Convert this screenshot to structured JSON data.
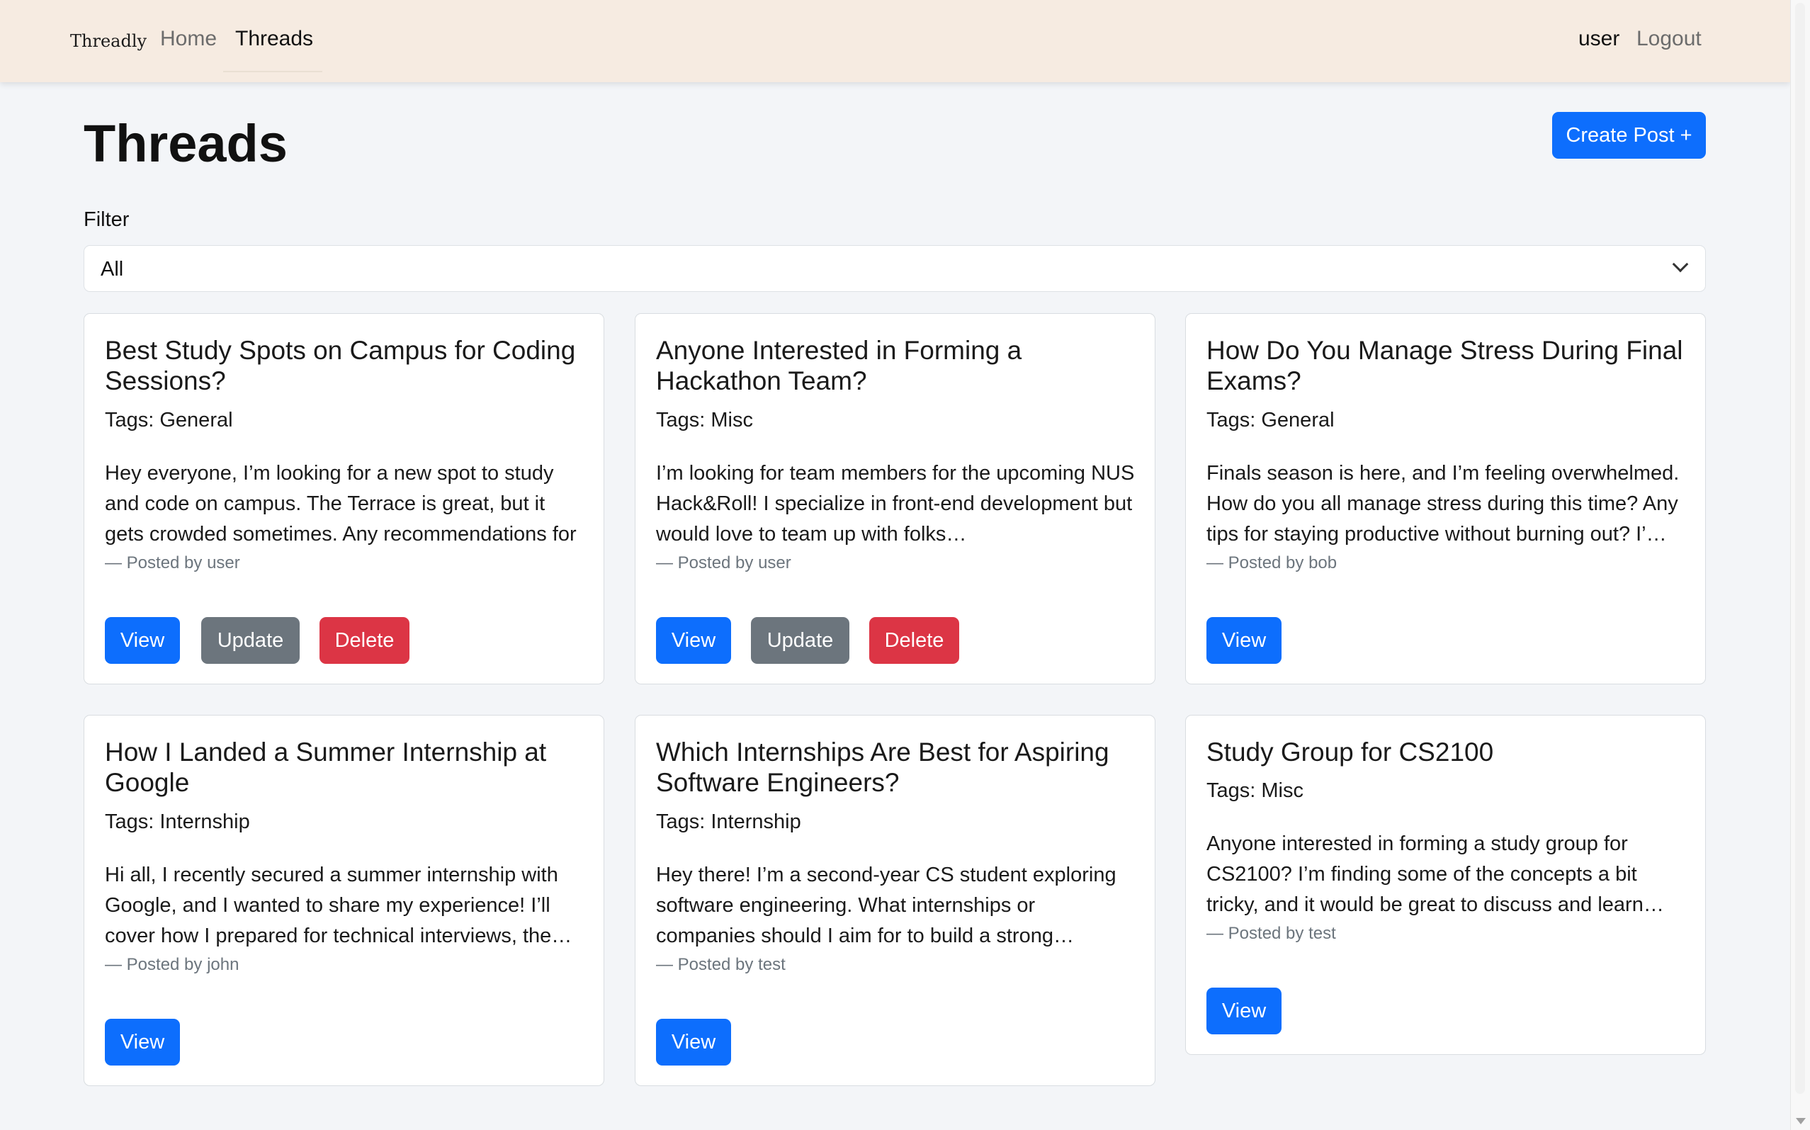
{
  "nav": {
    "brand": "Threadly",
    "home": "Home",
    "threads": "Threads",
    "user": "user",
    "logout": "Logout"
  },
  "header": {
    "title": "Threads",
    "create_label": "Create Post +"
  },
  "filter": {
    "label": "Filter",
    "value": "All"
  },
  "buttons": {
    "view": "View",
    "update": "Update",
    "delete": "Delete"
  },
  "threads": [
    {
      "title": "Best Study Spots on Campus for Coding Sessions?",
      "tags": "Tags: General",
      "body": "Hey everyone, I’m looking for a new spot to study and code on campus. The Terrace is great, but it gets crowded sometimes. Any recommendations for qui…",
      "author": "— Posted by user"
    },
    {
      "title": "Anyone Interested in Forming a Hackathon Team?",
      "tags": "Tags: Misc",
      "body": "I’m looking for team members for the upcoming NUS Hack&Roll! I specialize in front-end development but would love to team up with folks…",
      "author": "— Posted by user"
    },
    {
      "title": "How Do You Manage Stress During Final Exams?",
      "tags": "Tags: General",
      "body": "Finals season is here, and I’m feeling overwhelmed. How do you all manage stress during this time? Any tips for staying productive without burning out? I’…",
      "author": "— Posted by bob"
    },
    {
      "title": "How I Landed a Summer Internship at Google",
      "tags": "Tags: Internship",
      "body": "Hi all, I recently secured a summer internship with Google, and I wanted to share my experience! I’ll cover how I prepared for technical interviews, the…",
      "author": "— Posted by john"
    },
    {
      "title": "Which Internships Are Best for Aspiring Software Engineers?",
      "tags": "Tags: Internship",
      "body": "Hey there! I’m a second-year CS student exploring software engineering. What internships or companies should I aim for to build a strong…",
      "author": "— Posted by test"
    },
    {
      "title": "Study Group for CS2100",
      "tags": "Tags: Misc",
      "body": "Anyone interested in forming a study group for CS2100? I’m finding some of the concepts a bit tricky, and it would be great to discuss and learn…",
      "author": "— Posted by test"
    }
  ]
}
